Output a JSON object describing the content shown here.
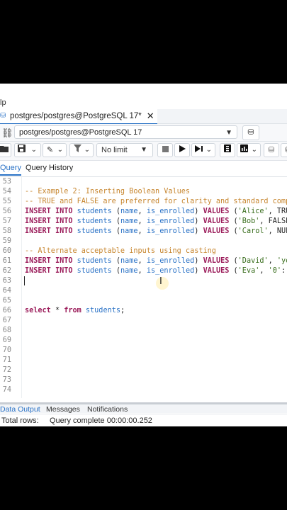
{
  "menu": {
    "fragment": "lp"
  },
  "tab": {
    "title": "postgres/postgres@PostgreSQL 17*",
    "close": "✕"
  },
  "connection": {
    "value": "postgres/postgres@PostgreSQL 17"
  },
  "toolbar": {
    "limit": "No limit"
  },
  "query_tabs": {
    "query": "Query",
    "history": "Query History"
  },
  "editor": {
    "lines": [
      {
        "n": "53",
        "code": ""
      },
      {
        "n": "54",
        "code": "-- Example 2: Inserting Boolean Values"
      },
      {
        "n": "55",
        "code": "-- TRUE and FALSE are preferred for clarity and standard comp"
      },
      {
        "n": "56",
        "code": "INSERT INTO students (name, is_enrolled) VALUES ('Alice', TRU"
      },
      {
        "n": "57",
        "code": "INSERT INTO students (name, is_enrolled) VALUES ('Bob', FALSE"
      },
      {
        "n": "58",
        "code": "INSERT INTO students (name, is_enrolled) VALUES ('Carol', NUL"
      },
      {
        "n": "59",
        "code": ""
      },
      {
        "n": "60",
        "code": "-- Alternate acceptable inputs using casting"
      },
      {
        "n": "61",
        "code": "INSERT INTO students (name, is_enrolled) VALUES ('David', 'ye"
      },
      {
        "n": "62",
        "code": "INSERT INTO students (name, is_enrolled) VALUES ('Eva', '0'::"
      },
      {
        "n": "63",
        "code": ""
      },
      {
        "n": "64",
        "code": ""
      },
      {
        "n": "65",
        "code": ""
      },
      {
        "n": "66",
        "code": "select * from students;"
      },
      {
        "n": "67",
        "code": ""
      },
      {
        "n": "68",
        "code": ""
      },
      {
        "n": "69",
        "code": ""
      },
      {
        "n": "70",
        "code": ""
      },
      {
        "n": "71",
        "code": ""
      },
      {
        "n": "72",
        "code": ""
      },
      {
        "n": "73",
        "code": ""
      },
      {
        "n": "74",
        "code": ""
      }
    ]
  },
  "bottom_tabs": {
    "data_output": "Data Output",
    "messages": "Messages",
    "notifications": "Notifications"
  },
  "status": {
    "total_rows": "Total rows:",
    "message": "Query complete 00:00:00.252"
  },
  "colors": {
    "accent": "#2a72c6",
    "keyword": "#9b1c5a",
    "comment": "#c7862f",
    "string": "#3a6e1e"
  }
}
